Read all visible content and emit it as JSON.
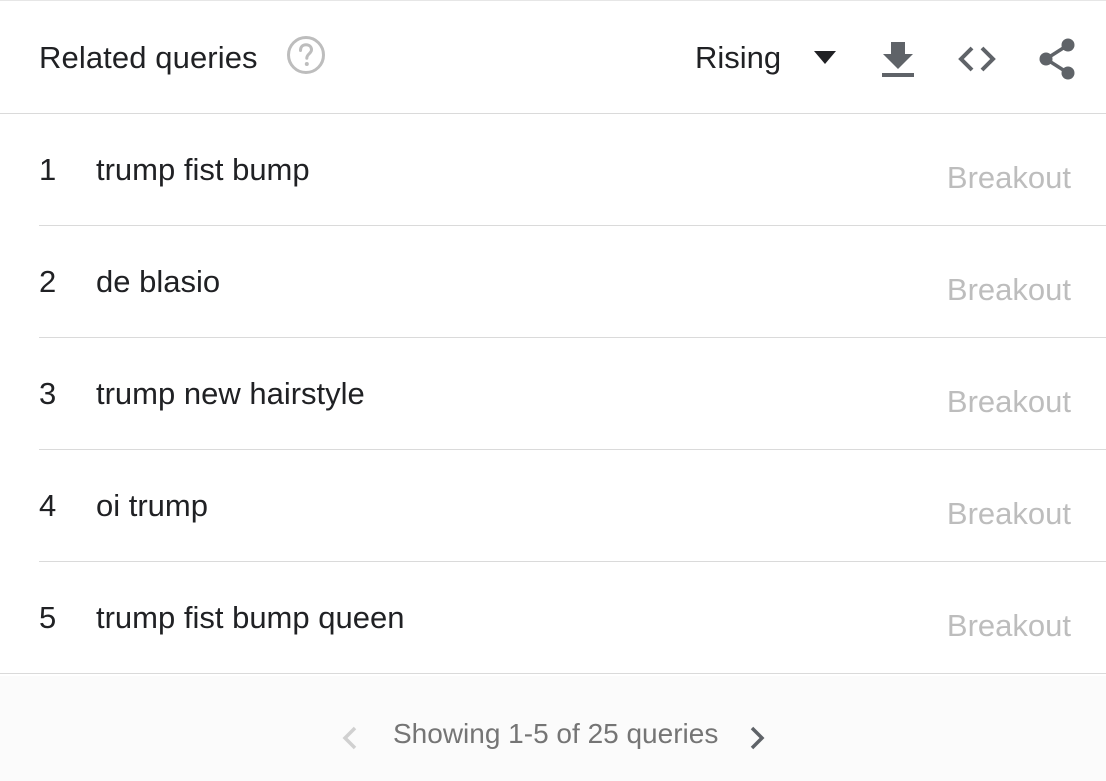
{
  "header": {
    "title": "Related queries",
    "help_icon": "help-circle-icon",
    "dropdown": {
      "selected": "Rising",
      "icon": "caret-down-icon"
    },
    "tools": {
      "download_icon": "download-icon",
      "embed_icon": "code-embed-icon",
      "share_icon": "share-icon"
    }
  },
  "rows": [
    {
      "rank": "1",
      "query": "trump fist bump",
      "value": "Breakout"
    },
    {
      "rank": "2",
      "query": "de blasio",
      "value": "Breakout"
    },
    {
      "rank": "3",
      "query": "trump new hairstyle",
      "value": "Breakout"
    },
    {
      "rank": "4",
      "query": "oi trump",
      "value": "Breakout"
    },
    {
      "rank": "5",
      "query": "trump fist bump queen",
      "value": "Breakout"
    }
  ],
  "footer": {
    "pager_text": "Showing 1-5 of 25 queries",
    "prev_icon": "chevron-left-icon",
    "next_icon": "chevron-right-icon"
  },
  "colors": {
    "text": "#202124",
    "muted": "#bdbdbd",
    "pager_text": "#757575",
    "icon": "#5f6368",
    "divider": "#dadada"
  }
}
